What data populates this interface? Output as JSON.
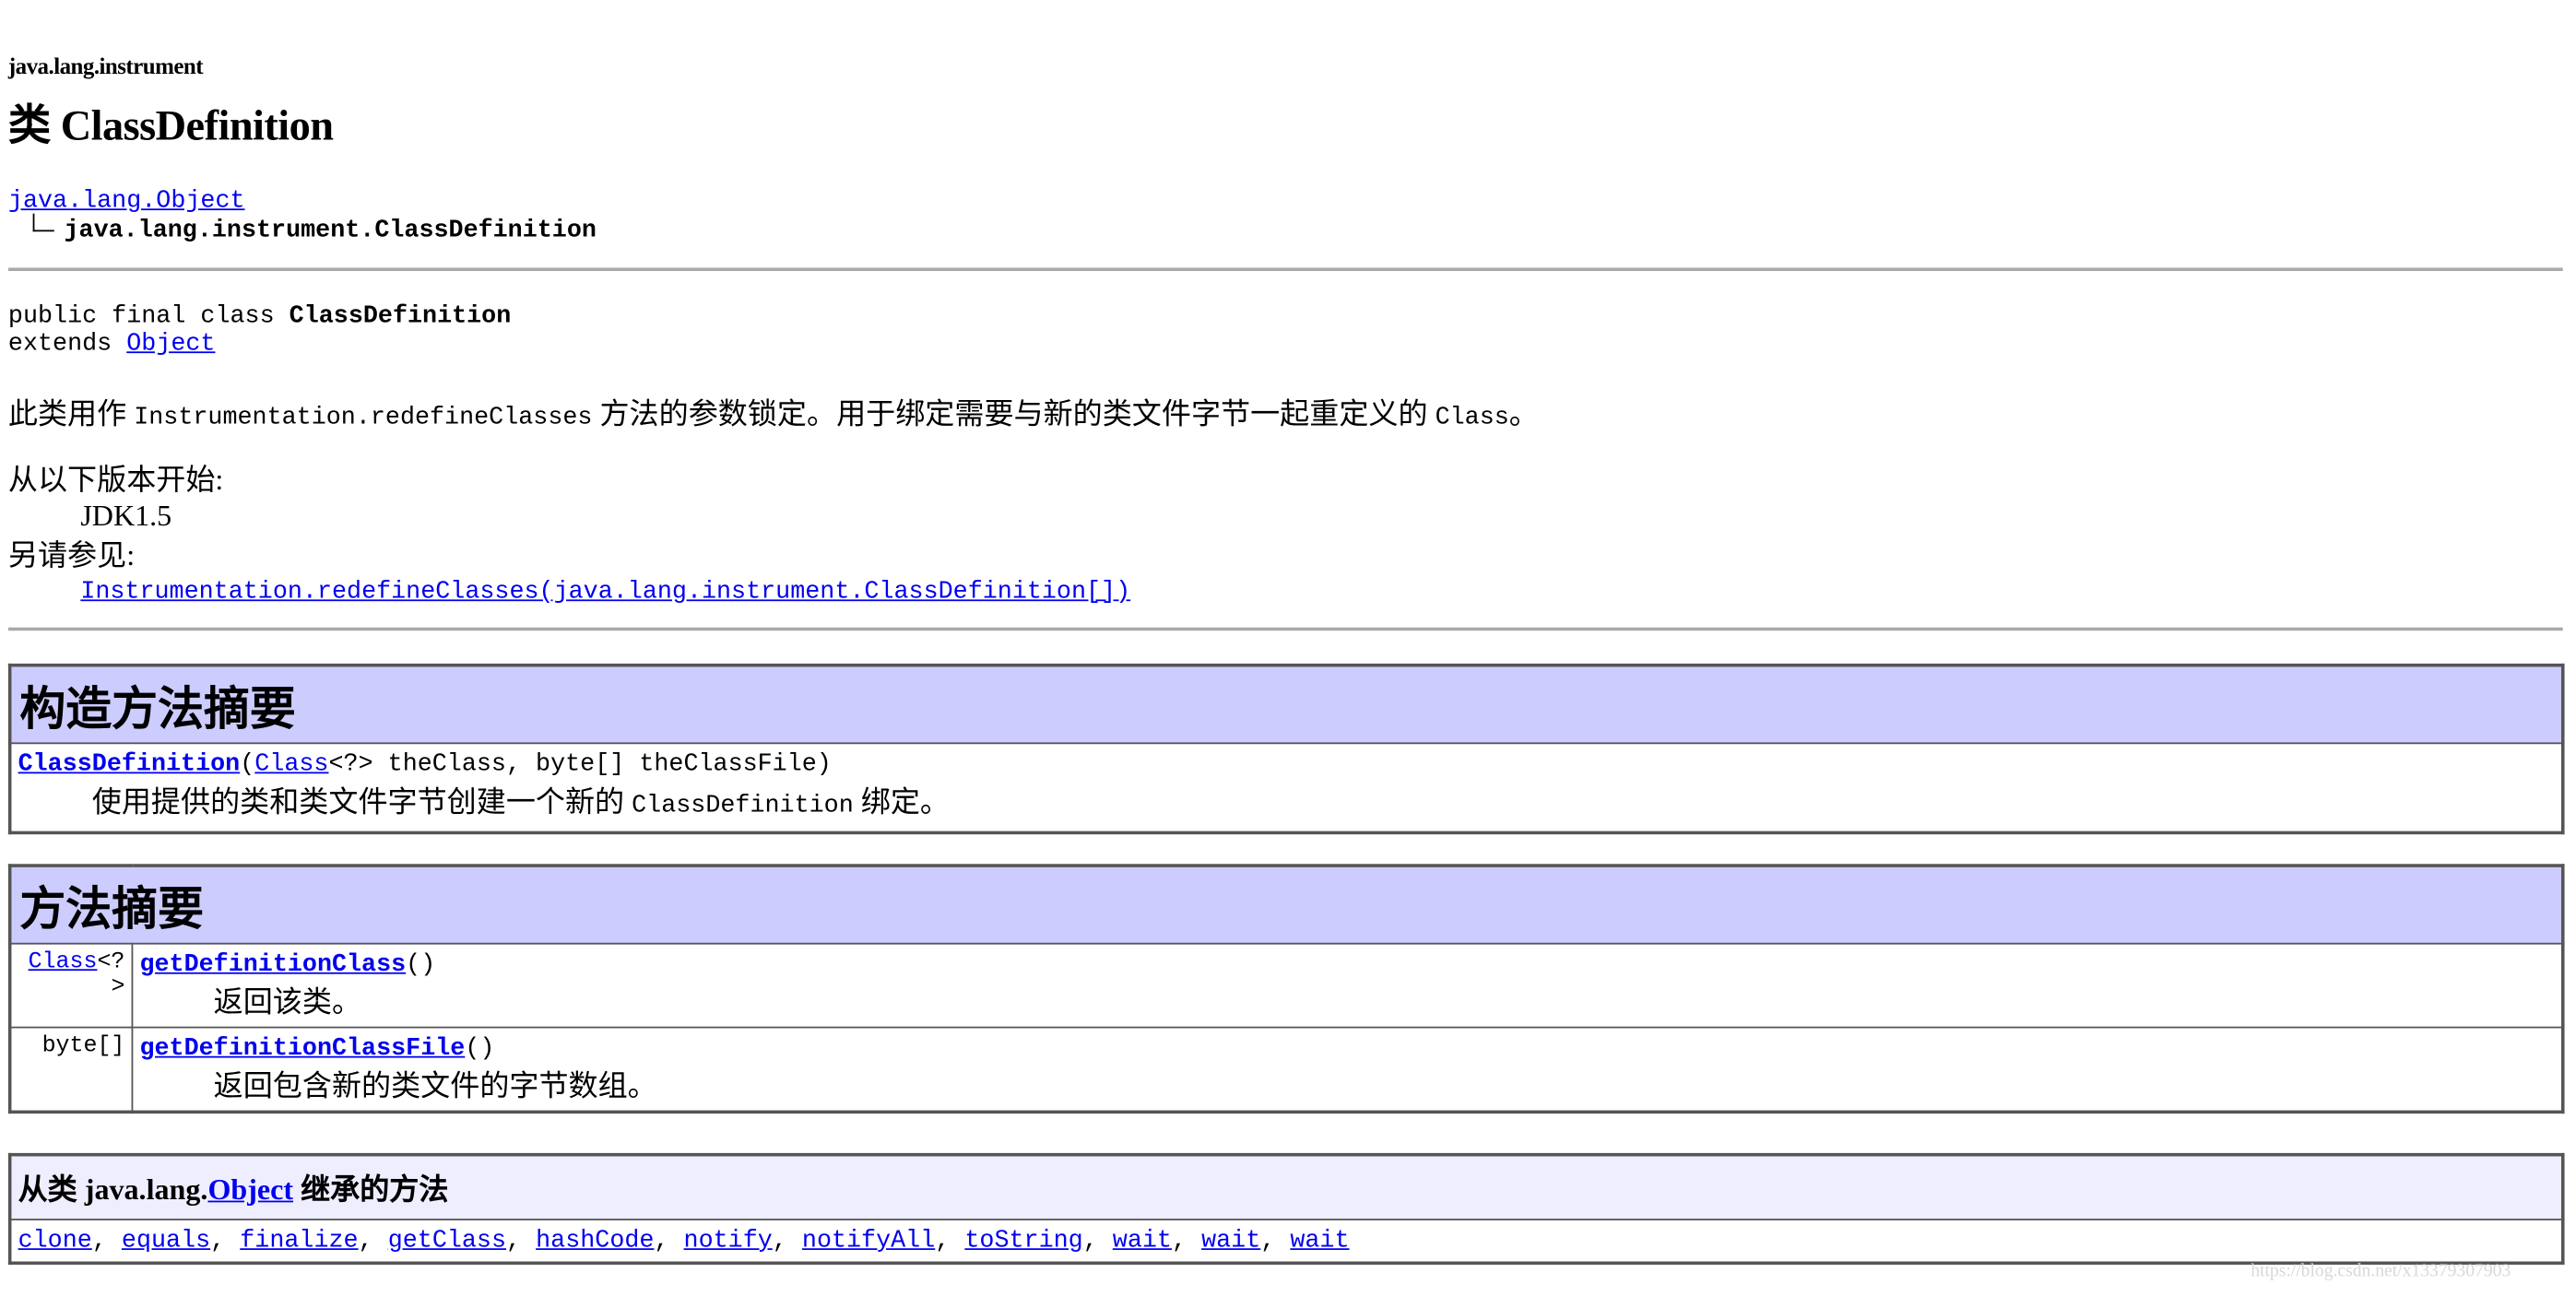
{
  "package_name": "java.lang.instrument",
  "class_title": "类 ClassDefinition",
  "hierarchy": {
    "parent": "java.lang.Object",
    "current": "java.lang.instrument.ClassDefinition"
  },
  "declaration": {
    "line1_prefix": "public final class ",
    "class_name": "ClassDefinition",
    "line2_prefix": "extends ",
    "extends_link": "Object"
  },
  "description": {
    "before": "此类用作 ",
    "code1": "Instrumentation.redefineClasses",
    "middle": " 方法的参数锁定。用于绑定需要与新的类文件字节一起重定义的 ",
    "code2": "Class",
    "after": "。"
  },
  "since": {
    "label": "从以下版本开始:",
    "value": "JDK1.5"
  },
  "see_also": {
    "label": "另请参见:",
    "link": "Instrumentation.redefineClasses(java.lang.instrument.ClassDefinition[])"
  },
  "constructor_summary": {
    "heading": "构造方法摘要",
    "name": "ClassDefinition",
    "open_paren": "(",
    "param_type_link": "Class",
    "params_rest": "<?> theClass, byte[] theClassFile)",
    "desc_before": "使用提供的类和类文件字节创建一个新的 ",
    "desc_code": "ClassDefinition",
    "desc_after": " 绑定。"
  },
  "method_summary": {
    "heading": "方法摘要",
    "rows": [
      {
        "type_link": "Class",
        "type_rest_a": "<?",
        "type_rest_b": ">",
        "name": "getDefinitionClass",
        "parens": "()",
        "desc": "返回该类。"
      },
      {
        "type_text": "byte[]",
        "name": "getDefinitionClassFile",
        "parens": "()",
        "desc": "返回包含新的类文件的字节数组。"
      }
    ]
  },
  "inherited": {
    "prefix": "从类 java.lang.",
    "class_link": "Object",
    "suffix": " 继承的方法",
    "methods": [
      "clone",
      "equals",
      "finalize",
      "getClass",
      "hashCode",
      "notify",
      "notifyAll",
      "toString",
      "wait",
      "wait",
      "wait"
    ]
  },
  "watermark": "https://blog.csdn.net/x13379307903",
  "colors": {
    "link": "#0000ee",
    "table_header": "#ccccff",
    "inherited_header": "#eeeeff",
    "separator": "#aaaaaa"
  }
}
